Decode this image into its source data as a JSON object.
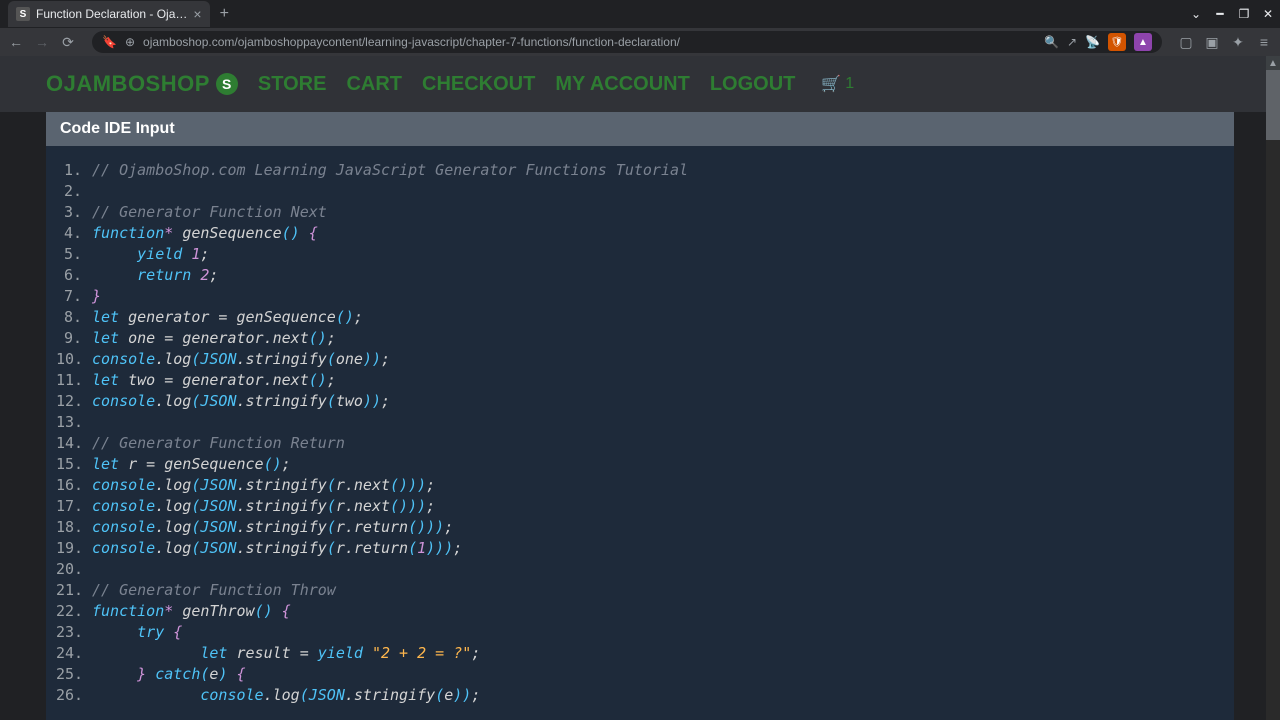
{
  "browser": {
    "tab_title": "Function Declaration - Oja…",
    "url": "ojamboshop.com/ojamboshoppaycontent/learning-javascript/chapter-7-functions/function-declaration/"
  },
  "nav": {
    "brand": "OJAMBOSHOP",
    "brand_badge": "S",
    "links": [
      "STORE",
      "CART",
      "CHECKOUT",
      "MY ACCOUNT",
      "LOGOUT"
    ],
    "cart_count": "1"
  },
  "panel": {
    "title": "Code IDE Input"
  },
  "code": {
    "lines": [
      {
        "n": "1.",
        "tokens": [
          [
            "c-comment",
            "// OjamboShop.com Learning JavaScript Generator Functions Tutorial"
          ]
        ]
      },
      {
        "n": "2.",
        "tokens": []
      },
      {
        "n": "3.",
        "tokens": [
          [
            "c-comment",
            "// Generator Function Next"
          ]
        ]
      },
      {
        "n": "4.",
        "tokens": [
          [
            "c-kw",
            "function"
          ],
          [
            "c-kw2",
            "*"
          ],
          [
            "",
            " "
          ],
          [
            "c-fn",
            "genSequence"
          ],
          [
            "c-paren",
            "()"
          ],
          [
            "",
            " "
          ],
          [
            "c-brace",
            "{"
          ]
        ]
      },
      {
        "n": "5.",
        "tokens": [
          [
            "",
            "     "
          ],
          [
            "c-kw",
            "yield"
          ],
          [
            "",
            " "
          ],
          [
            "c-num",
            "1"
          ],
          [
            "",
            ";"
          ]
        ]
      },
      {
        "n": "6.",
        "tokens": [
          [
            "",
            "     "
          ],
          [
            "c-kw",
            "return"
          ],
          [
            "",
            " "
          ],
          [
            "c-num",
            "2"
          ],
          [
            "",
            ";"
          ]
        ]
      },
      {
        "n": "7.",
        "tokens": [
          [
            "c-brace",
            "}"
          ]
        ]
      },
      {
        "n": "8.",
        "tokens": [
          [
            "c-kw",
            "let"
          ],
          [
            "",
            " "
          ],
          [
            "c-var",
            "generator"
          ],
          [
            "",
            " = "
          ],
          [
            "c-fn",
            "genSequence"
          ],
          [
            "c-paren",
            "()"
          ],
          [
            "",
            ";"
          ]
        ]
      },
      {
        "n": "9.",
        "tokens": [
          [
            "c-kw",
            "let"
          ],
          [
            "",
            " "
          ],
          [
            "c-var",
            "one"
          ],
          [
            "",
            " = "
          ],
          [
            "c-var",
            "generator"
          ],
          [
            "c-dot",
            "."
          ],
          [
            "c-method",
            "next"
          ],
          [
            "c-paren",
            "()"
          ],
          [
            "",
            ";"
          ]
        ]
      },
      {
        "n": "10.",
        "tokens": [
          [
            "c-obj",
            "console"
          ],
          [
            "c-dot",
            "."
          ],
          [
            "c-method",
            "log"
          ],
          [
            "c-paren",
            "("
          ],
          [
            "c-obj",
            "JSON"
          ],
          [
            "c-dot",
            "."
          ],
          [
            "c-method",
            "stringify"
          ],
          [
            "c-paren",
            "("
          ],
          [
            "c-var",
            "one"
          ],
          [
            "c-paren",
            "))"
          ],
          [
            "",
            ";"
          ]
        ]
      },
      {
        "n": "11.",
        "tokens": [
          [
            "c-kw",
            "let"
          ],
          [
            "",
            " "
          ],
          [
            "c-var",
            "two"
          ],
          [
            "",
            " = "
          ],
          [
            "c-var",
            "generator"
          ],
          [
            "c-dot",
            "."
          ],
          [
            "c-method",
            "next"
          ],
          [
            "c-paren",
            "()"
          ],
          [
            "",
            ";"
          ]
        ]
      },
      {
        "n": "12.",
        "tokens": [
          [
            "c-obj",
            "console"
          ],
          [
            "c-dot",
            "."
          ],
          [
            "c-method",
            "log"
          ],
          [
            "c-paren",
            "("
          ],
          [
            "c-obj",
            "JSON"
          ],
          [
            "c-dot",
            "."
          ],
          [
            "c-method",
            "stringify"
          ],
          [
            "c-paren",
            "("
          ],
          [
            "c-var",
            "two"
          ],
          [
            "c-paren",
            "))"
          ],
          [
            "",
            ";"
          ]
        ]
      },
      {
        "n": "13.",
        "tokens": []
      },
      {
        "n": "14.",
        "tokens": [
          [
            "c-comment",
            "// Generator Function Return"
          ]
        ]
      },
      {
        "n": "15.",
        "tokens": [
          [
            "c-kw",
            "let"
          ],
          [
            "",
            " "
          ],
          [
            "c-var",
            "r"
          ],
          [
            "",
            " = "
          ],
          [
            "c-fn",
            "genSequence"
          ],
          [
            "c-paren",
            "()"
          ],
          [
            "",
            ";"
          ]
        ]
      },
      {
        "n": "16.",
        "tokens": [
          [
            "c-obj",
            "console"
          ],
          [
            "c-dot",
            "."
          ],
          [
            "c-method",
            "log"
          ],
          [
            "c-paren",
            "("
          ],
          [
            "c-obj",
            "JSON"
          ],
          [
            "c-dot",
            "."
          ],
          [
            "c-method",
            "stringify"
          ],
          [
            "c-paren",
            "("
          ],
          [
            "c-var",
            "r"
          ],
          [
            "c-dot",
            "."
          ],
          [
            "c-method",
            "next"
          ],
          [
            "c-paren",
            "()))"
          ],
          [
            "",
            ";"
          ]
        ]
      },
      {
        "n": "17.",
        "tokens": [
          [
            "c-obj",
            "console"
          ],
          [
            "c-dot",
            "."
          ],
          [
            "c-method",
            "log"
          ],
          [
            "c-paren",
            "("
          ],
          [
            "c-obj",
            "JSON"
          ],
          [
            "c-dot",
            "."
          ],
          [
            "c-method",
            "stringify"
          ],
          [
            "c-paren",
            "("
          ],
          [
            "c-var",
            "r"
          ],
          [
            "c-dot",
            "."
          ],
          [
            "c-method",
            "next"
          ],
          [
            "c-paren",
            "()))"
          ],
          [
            "",
            ";"
          ]
        ]
      },
      {
        "n": "18.",
        "tokens": [
          [
            "c-obj",
            "console"
          ],
          [
            "c-dot",
            "."
          ],
          [
            "c-method",
            "log"
          ],
          [
            "c-paren",
            "("
          ],
          [
            "c-obj",
            "JSON"
          ],
          [
            "c-dot",
            "."
          ],
          [
            "c-method",
            "stringify"
          ],
          [
            "c-paren",
            "("
          ],
          [
            "c-var",
            "r"
          ],
          [
            "c-dot",
            "."
          ],
          [
            "c-method",
            "return"
          ],
          [
            "c-paren",
            "()))"
          ],
          [
            "",
            ";"
          ]
        ]
      },
      {
        "n": "19.",
        "tokens": [
          [
            "c-obj",
            "console"
          ],
          [
            "c-dot",
            "."
          ],
          [
            "c-method",
            "log"
          ],
          [
            "c-paren",
            "("
          ],
          [
            "c-obj",
            "JSON"
          ],
          [
            "c-dot",
            "."
          ],
          [
            "c-method",
            "stringify"
          ],
          [
            "c-paren",
            "("
          ],
          [
            "c-var",
            "r"
          ],
          [
            "c-dot",
            "."
          ],
          [
            "c-method",
            "return"
          ],
          [
            "c-paren",
            "("
          ],
          [
            "c-num",
            "1"
          ],
          [
            "c-paren",
            ")))"
          ],
          [
            "",
            ";"
          ]
        ]
      },
      {
        "n": "20.",
        "tokens": []
      },
      {
        "n": "21.",
        "tokens": [
          [
            "c-comment",
            "// Generator Function Throw"
          ]
        ]
      },
      {
        "n": "22.",
        "tokens": [
          [
            "c-kw",
            "function"
          ],
          [
            "c-kw2",
            "*"
          ],
          [
            "",
            " "
          ],
          [
            "c-fn",
            "genThrow"
          ],
          [
            "c-paren",
            "()"
          ],
          [
            "",
            " "
          ],
          [
            "c-brace",
            "{"
          ]
        ]
      },
      {
        "n": "23.",
        "tokens": [
          [
            "",
            "     "
          ],
          [
            "c-kw",
            "try"
          ],
          [
            "",
            " "
          ],
          [
            "c-brace",
            "{"
          ]
        ]
      },
      {
        "n": "24.",
        "tokens": [
          [
            "",
            "            "
          ],
          [
            "c-kw",
            "let"
          ],
          [
            "",
            " "
          ],
          [
            "c-var",
            "result"
          ],
          [
            "",
            " = "
          ],
          [
            "c-kw",
            "yield"
          ],
          [
            "",
            " "
          ],
          [
            "c-str",
            "\"2 + 2 = ?\""
          ],
          [
            "",
            ";"
          ]
        ]
      },
      {
        "n": "25.",
        "tokens": [
          [
            "",
            "     "
          ],
          [
            "c-brace",
            "}"
          ],
          [
            "",
            " "
          ],
          [
            "c-kw",
            "catch"
          ],
          [
            "c-paren",
            "("
          ],
          [
            "c-var",
            "e"
          ],
          [
            "c-paren",
            ")"
          ],
          [
            "",
            " "
          ],
          [
            "c-brace",
            "{"
          ]
        ]
      },
      {
        "n": "26.",
        "tokens": [
          [
            "",
            "            "
          ],
          [
            "c-obj",
            "console"
          ],
          [
            "c-dot",
            "."
          ],
          [
            "c-method",
            "log"
          ],
          [
            "c-paren",
            "("
          ],
          [
            "c-obj",
            "JSON"
          ],
          [
            "c-dot",
            "."
          ],
          [
            "c-method",
            "stringify"
          ],
          [
            "c-paren",
            "("
          ],
          [
            "c-var",
            "e"
          ],
          [
            "c-paren",
            "))"
          ],
          [
            "",
            ";"
          ]
        ]
      }
    ]
  }
}
